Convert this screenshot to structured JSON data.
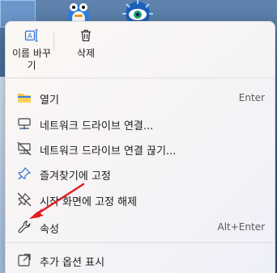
{
  "top_actions": {
    "rename_label": "이름 바꾸기",
    "delete_label": "삭제"
  },
  "items": [
    {
      "label": "열기",
      "shortcut": "Enter",
      "icon": "folder-icon"
    },
    {
      "label": "네트워크 드라이브 연결...",
      "shortcut": "",
      "icon": "network-drive-icon"
    },
    {
      "label": "네트워크 드라이브 연결 끊기...",
      "shortcut": "",
      "icon": "network-drive-disconnect-icon"
    },
    {
      "label": "즐겨찾기에 고정",
      "shortcut": "",
      "icon": "pin-icon"
    },
    {
      "label": "시작 화면에 고정 해제",
      "shortcut": "",
      "icon": "unpin-icon"
    },
    {
      "label": "속성",
      "shortcut": "Alt+Enter",
      "icon": "wrench-icon"
    },
    {
      "label": "추가 옵션 표시",
      "shortcut": "",
      "icon": "more-options-icon"
    }
  ],
  "colors": {
    "accent_blue": "#2f6fd6",
    "folder_yellow": "#f5c542",
    "arrow_red": "#e02020"
  }
}
